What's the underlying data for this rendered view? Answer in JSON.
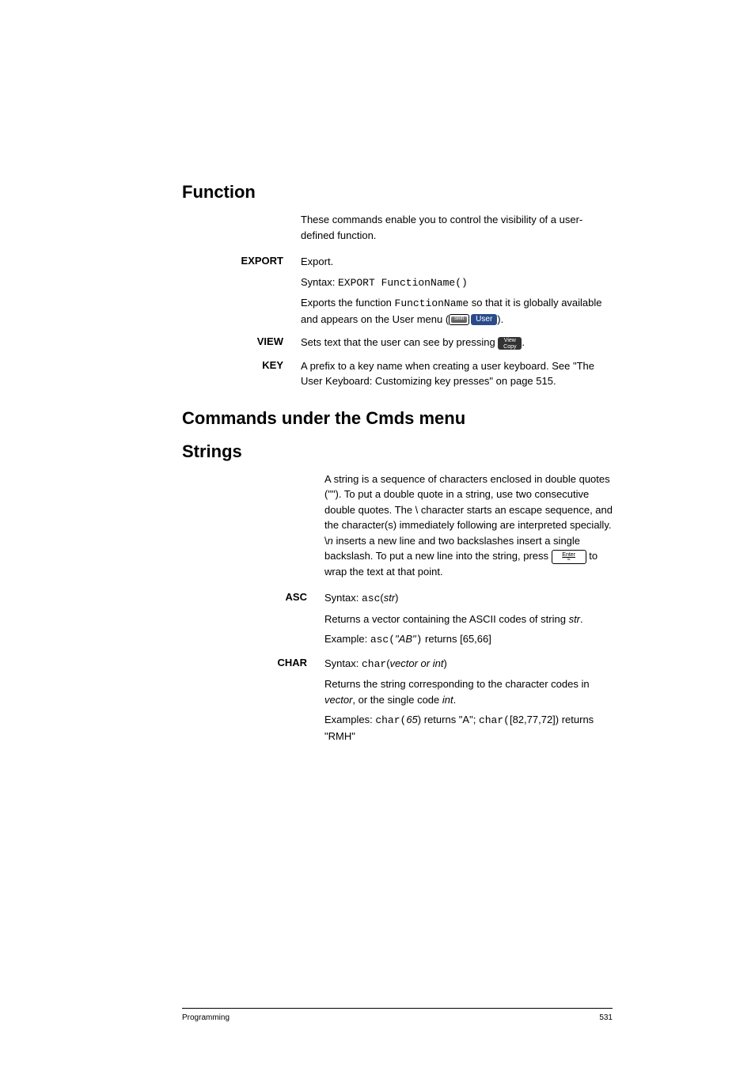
{
  "sections": {
    "function": {
      "heading": "Function",
      "intro": "These commands enable you to control the visibility of a user-defined function.",
      "entries": {
        "export": {
          "label": "EXPORT",
          "p1": "Export.",
          "p2_prefix": "Syntax: ",
          "p2_code": "EXPORT FunctionName()",
          "p3_a": "Exports the function ",
          "p3_code": "FunctionName",
          "p3_b": " so that it is globally available and appears on the User menu (",
          "p3_user": "User",
          "p3_c": ")."
        },
        "view": {
          "label": "VIEW",
          "p1": "Sets text that the user can see by pressing ",
          "p1_key_top": "View",
          "p1_key_bot": "Copy",
          "p1_end": "."
        },
        "key": {
          "label": "KEY",
          "p1": "A prefix to a key name when creating a user keyboard. See \"The User Keyboard: Customizing key presses\" on page 515."
        }
      }
    },
    "commands": {
      "heading": "Commands under the Cmds menu"
    },
    "strings": {
      "heading": "Strings",
      "intro_a": "A string is a sequence of characters enclosed in double quotes (\"\"). To put a double quote in a string, use two consecutive double quotes. The \\ character starts an escape sequence, and the character(s) immediately following are interpreted specially. \\",
      "intro_n": "n",
      "intro_b": " inserts a new line and two backslashes insert a single backslash. To put a new line into the string, press ",
      "intro_c": " to wrap the text at that point.",
      "entries": {
        "asc": {
          "label": "ASC",
          "p1_prefix": "Syntax: ",
          "p1_code": "asc",
          "p1_open": "(",
          "p1_arg": "str",
          "p1_close": ")",
          "p2_a": "Returns a vector containing the ASCII codes of string ",
          "p2_arg": "str",
          "p2_b": ".",
          "p3_prefix": "Example: ",
          "p3_code": "asc(",
          "p3_arg": "\"AB\"",
          "p3_close": ")",
          "p3_b": " returns [65,66]"
        },
        "char": {
          "label": "CHAR",
          "p1_prefix": "Syntax: ",
          "p1_code": "char",
          "p1_open": "(",
          "p1_arg": "vector or int",
          "p1_close": ")",
          "p2_a": "Returns the string corresponding to the character codes in ",
          "p2_arg1": "vector",
          "p2_b": ", or the single code ",
          "p2_arg2": "int",
          "p2_c": ".",
          "p3_prefix": "Examples: ",
          "p3_code1": "char(",
          "p3_arg1": "65",
          "p3_mid": ") returns \"A\"; ",
          "p3_code2": "char(",
          "p3_arg2": "[82,77,72]) returns \"RMH\""
        }
      }
    }
  },
  "footer": {
    "left": "Programming",
    "right": "531"
  }
}
